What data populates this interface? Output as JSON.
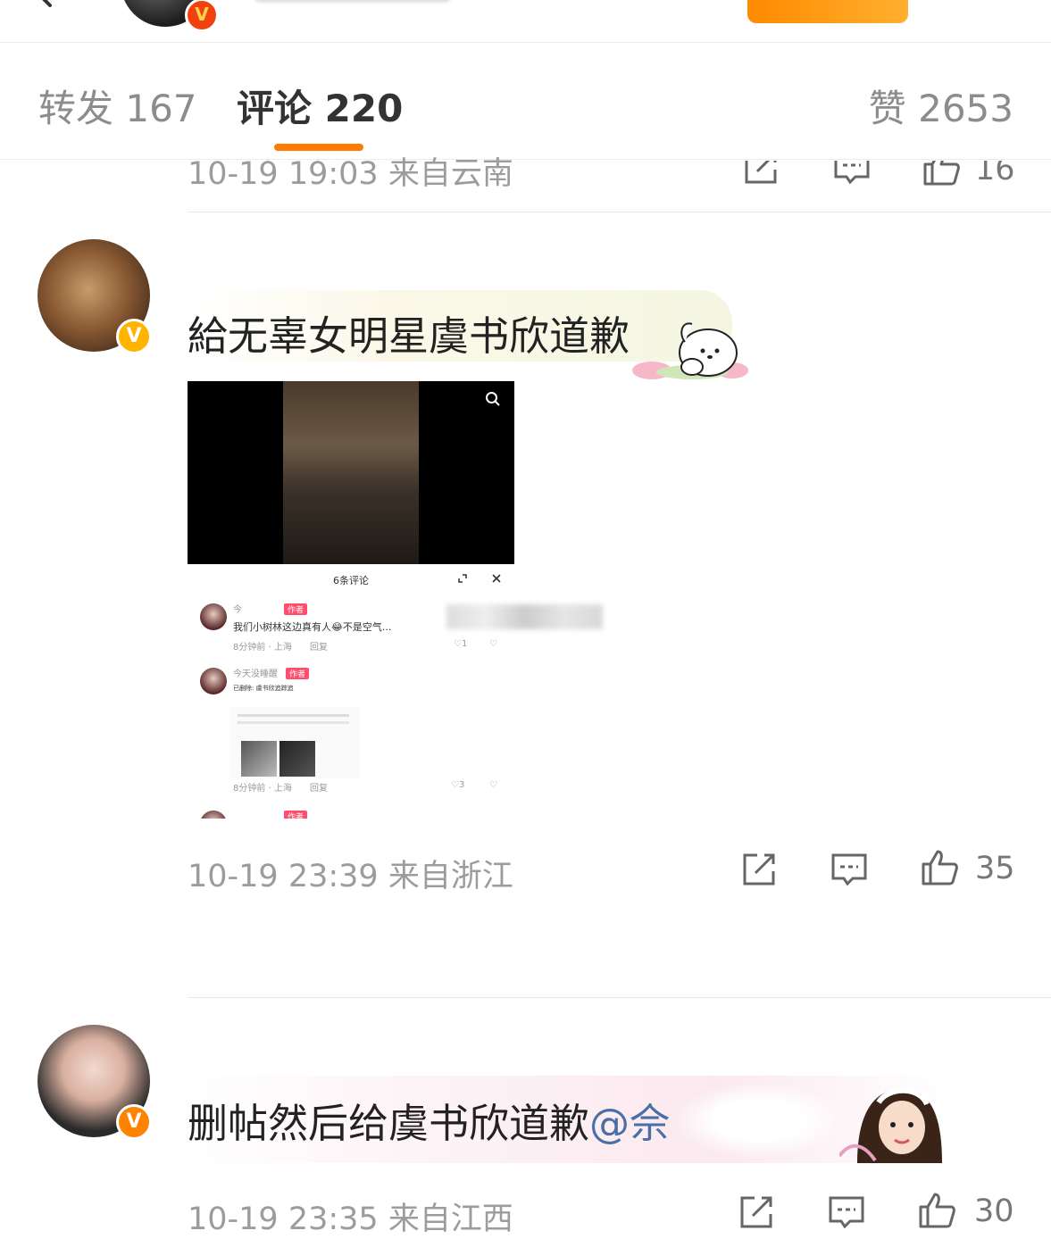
{
  "tabs": {
    "repost": "转发 167",
    "comments": "评论 220",
    "likes": "赞 2653"
  },
  "top": {
    "badge": "V"
  },
  "comments": [
    {
      "time": "10-19 19:03",
      "location": "来自云南",
      "like_count": "16"
    },
    {
      "text": "給无辜女明星虞书欣道歉",
      "badge": "V",
      "time": "10-19 23:39",
      "location": "来自浙江",
      "like_count": "35",
      "screenshot": {
        "panel_title": "6条评论",
        "item1_name": "今",
        "author_tag": "作者",
        "item1_text": "我们小树林这边真有人😂不是空气...",
        "item1_meta": "8分钟前 · 上海",
        "reply": "回复",
        "item1_likes": "1",
        "item2_name": "今天没睡醒",
        "item2_sub": "已删除: 虞书欣追踪追",
        "item2_meta": "8分钟前 · 上海",
        "item2_likes": "3"
      }
    },
    {
      "text": "删帖然后给虞书欣道歉",
      "mention": "@佘",
      "badge": "V",
      "time": "10-19 23:35",
      "location": "来自江西",
      "like_count": "30"
    }
  ]
}
